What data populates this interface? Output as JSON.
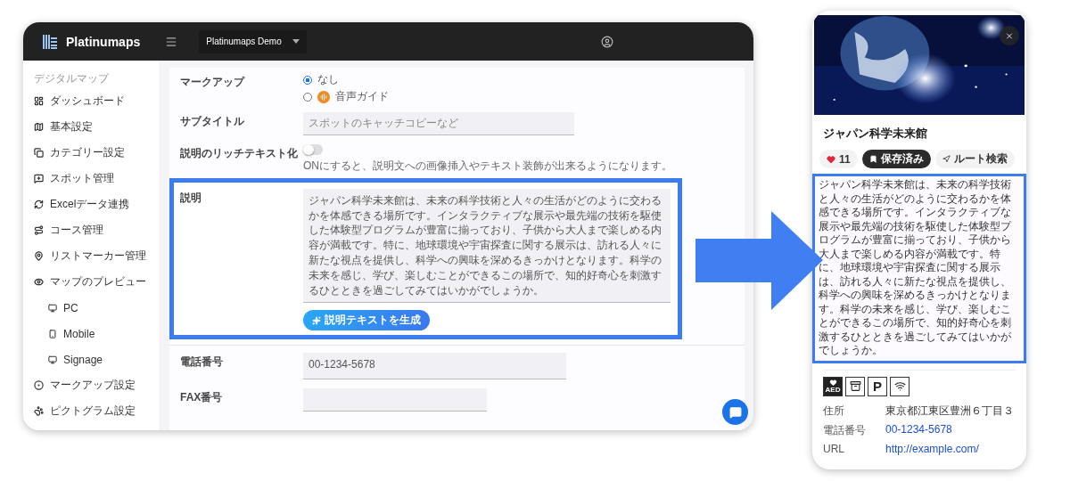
{
  "app": {
    "logo": "Platinumaps",
    "project": "Platinumaps Demo"
  },
  "sidebar": {
    "section": "デジタルマップ",
    "items": [
      {
        "label": "ダッシュボード"
      },
      {
        "label": "基本設定"
      },
      {
        "label": "カテゴリー設定"
      },
      {
        "label": "スポット管理"
      },
      {
        "label": "Excelデータ連携"
      },
      {
        "label": "コース管理"
      },
      {
        "label": "リストマーカー管理"
      },
      {
        "label": "マップのプレビュー",
        "children": [
          {
            "label": "PC"
          },
          {
            "label": "Mobile"
          },
          {
            "label": "Signage"
          }
        ]
      },
      {
        "label": "マークアップ設定"
      },
      {
        "label": "ピクトグラム設定"
      }
    ]
  },
  "form": {
    "markup": {
      "label": "マークアップ",
      "options": [
        {
          "label": "なし",
          "selected": true
        },
        {
          "label": "音声ガイド",
          "selected": false
        }
      ]
    },
    "subtitle": {
      "label": "サブタイトル",
      "placeholder": "スポットのキャッチコピーなど"
    },
    "rich_text": {
      "label": "説明のリッチテキスト化",
      "on": false,
      "hint": "ONにすると、説明文への画像挿入やテキスト装飾が出来るようになります。"
    },
    "description": {
      "label": "説明",
      "value": "ジャパン科学未来館は、未来の科学技術と人々の生活がどのように交わるかを体感できる場所です。インタラクティブな展示や最先端の技術を駆使した体験型プログラムが豊富に揃っており、子供から大人まで楽しめる内容が満載です。特に、地球環境や宇宙探査に関する展示は、訪れる人々に新たな視点を提供し、科学への興味を深めるきっかけとなります。科学の未来を感じ、学び、楽しむことができるこの場所で、知的好奇心を刺激するひとときを過ごしてみてはいかがでしょうか。",
      "button": "説明テキストを生成"
    },
    "phone": {
      "label": "電話番号",
      "value": "00-1234-5678"
    },
    "fax": {
      "label": "FAX番号"
    }
  },
  "preview": {
    "title": "ジャパン科学未来館",
    "likes": "11",
    "actions": [
      {
        "label": "保存済み",
        "selected": true
      },
      {
        "label": "ルート検索",
        "selected": false
      }
    ],
    "description": "ジャパン科学未来館は、未来の科学技術と人々の生活がどのように交わるかを体感できる場所です。インタラクティブな展示や最先端の技術を駆使した体験型プログラムが豊富に揃っており、子供から大人まで楽しめる内容が満載です。特に、地球環境や宇宙探査に関する展示は、訪れる人々に新たな視点を提供し、科学への興味を深めるきっかけとなります。科学の未来を感じ、学び、楽しむことができるこの場所で、知的好奇心を刺激するひとときを過ごしてみてはいかがでしょうか。",
    "pictograms": [
      {
        "kind": "aed",
        "label": "AED"
      },
      {
        "kind": "locker"
      },
      {
        "kind": "parking",
        "label": "P"
      },
      {
        "kind": "wifi"
      }
    ],
    "info": [
      {
        "label": "住所",
        "value": "東京都江東区豊洲６丁目３",
        "link": false
      },
      {
        "label": "電話番号",
        "value": "00-1234-5678",
        "link": true
      },
      {
        "label": "URL",
        "value": "http://example.com/",
        "link": true
      }
    ]
  }
}
